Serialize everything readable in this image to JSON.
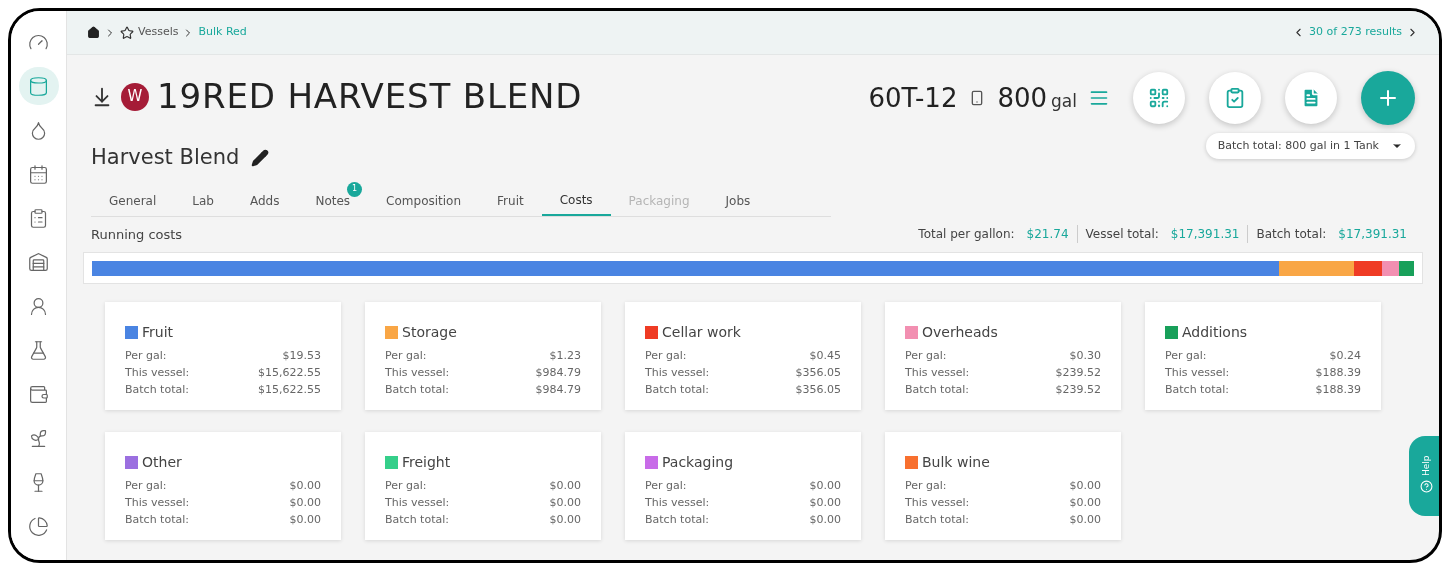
{
  "sidebar": {
    "items": [
      {
        "selected": false
      },
      {
        "selected": true
      },
      {
        "selected": false
      },
      {
        "selected": false
      },
      {
        "selected": false
      },
      {
        "selected": false
      },
      {
        "selected": false
      },
      {
        "selected": false
      },
      {
        "selected": false
      },
      {
        "selected": false
      },
      {
        "selected": false
      },
      {
        "selected": false
      }
    ]
  },
  "breadcrumb": {
    "items": [
      {
        "kind": "home"
      },
      {
        "kind": "star",
        "label": "Vessels"
      },
      {
        "kind": "current",
        "label": "Bulk Red"
      }
    ],
    "results": "30 of 273 results"
  },
  "header": {
    "badge": "W",
    "title": "19RED HARVEST BLEND",
    "subtitle": "Harvest Blend",
    "vessel": "60T-12",
    "volume": "800",
    "unit": "gal",
    "batch_select": "Batch total: 800 gal in 1 Tank"
  },
  "tabs": [
    {
      "label": "General",
      "selected": false,
      "disabled": false
    },
    {
      "label": "Lab",
      "selected": false,
      "disabled": false
    },
    {
      "label": "Adds",
      "selected": false,
      "disabled": false
    },
    {
      "label": "Notes",
      "selected": false,
      "disabled": false,
      "badge": "1"
    },
    {
      "label": "Composition",
      "selected": false,
      "disabled": false
    },
    {
      "label": "Fruit",
      "selected": false,
      "disabled": false
    },
    {
      "label": "Costs",
      "selected": true,
      "disabled": false
    },
    {
      "label": "Packaging",
      "selected": false,
      "disabled": true
    },
    {
      "label": "Jobs",
      "selected": false,
      "disabled": false
    }
  ],
  "running_costs": {
    "title": "Running costs",
    "totals": [
      {
        "label": "Total per gallon:",
        "value": "$21.74"
      },
      {
        "label": "Vessel total:",
        "value": "$17,391.31"
      },
      {
        "label": "Batch total:",
        "value": "$17,391.31"
      }
    ],
    "bar": [
      {
        "color": "#4a84e2"
      },
      {
        "color": "#f9a645"
      },
      {
        "color": "#ef3b24"
      },
      {
        "color": "#f28fb1"
      },
      {
        "color": "#18a05a"
      }
    ]
  },
  "cards": [
    {
      "name": "Fruit",
      "color": "#4a84e2",
      "rows": [
        {
          "label": "Per gal:",
          "value": "$19.53"
        },
        {
          "label": "This vessel:",
          "value": "$15,622.55"
        },
        {
          "label": "Batch total:",
          "value": "$15,622.55"
        }
      ]
    },
    {
      "name": "Storage",
      "color": "#f9a645",
      "rows": [
        {
          "label": "Per gal:",
          "value": "$1.23"
        },
        {
          "label": "This vessel:",
          "value": "$984.79"
        },
        {
          "label": "Batch total:",
          "value": "$984.79"
        }
      ]
    },
    {
      "name": "Cellar work",
      "color": "#ef3b24",
      "rows": [
        {
          "label": "Per gal:",
          "value": "$0.45"
        },
        {
          "label": "This vessel:",
          "value": "$356.05"
        },
        {
          "label": "Batch total:",
          "value": "$356.05"
        }
      ]
    },
    {
      "name": "Overheads",
      "color": "#f28fb1",
      "rows": [
        {
          "label": "Per gal:",
          "value": "$0.30"
        },
        {
          "label": "This vessel:",
          "value": "$239.52"
        },
        {
          "label": "Batch total:",
          "value": "$239.52"
        }
      ]
    },
    {
      "name": "Additions",
      "color": "#18a05a",
      "rows": [
        {
          "label": "Per gal:",
          "value": "$0.24"
        },
        {
          "label": "This vessel:",
          "value": "$188.39"
        },
        {
          "label": "Batch total:",
          "value": "$188.39"
        }
      ]
    },
    {
      "name": "Other",
      "color": "#9b6fe0",
      "rows": [
        {
          "label": "Per gal:",
          "value": "$0.00"
        },
        {
          "label": "This vessel:",
          "value": "$0.00"
        },
        {
          "label": "Batch total:",
          "value": "$0.00"
        }
      ]
    },
    {
      "name": "Freight",
      "color": "#35cf8a",
      "rows": [
        {
          "label": "Per gal:",
          "value": "$0.00"
        },
        {
          "label": "This vessel:",
          "value": "$0.00"
        },
        {
          "label": "Batch total:",
          "value": "$0.00"
        }
      ]
    },
    {
      "name": "Packaging",
      "color": "#c86be8",
      "rows": [
        {
          "label": "Per gal:",
          "value": "$0.00"
        },
        {
          "label": "This vessel:",
          "value": "$0.00"
        },
        {
          "label": "Batch total:",
          "value": "$0.00"
        }
      ]
    },
    {
      "name": "Bulk wine",
      "color": "#f8702f",
      "rows": [
        {
          "label": "Per gal:",
          "value": "$0.00"
        },
        {
          "label": "This vessel:",
          "value": "$0.00"
        },
        {
          "label": "Batch total:",
          "value": "$0.00"
        }
      ]
    }
  ],
  "help": {
    "label": "Help"
  }
}
